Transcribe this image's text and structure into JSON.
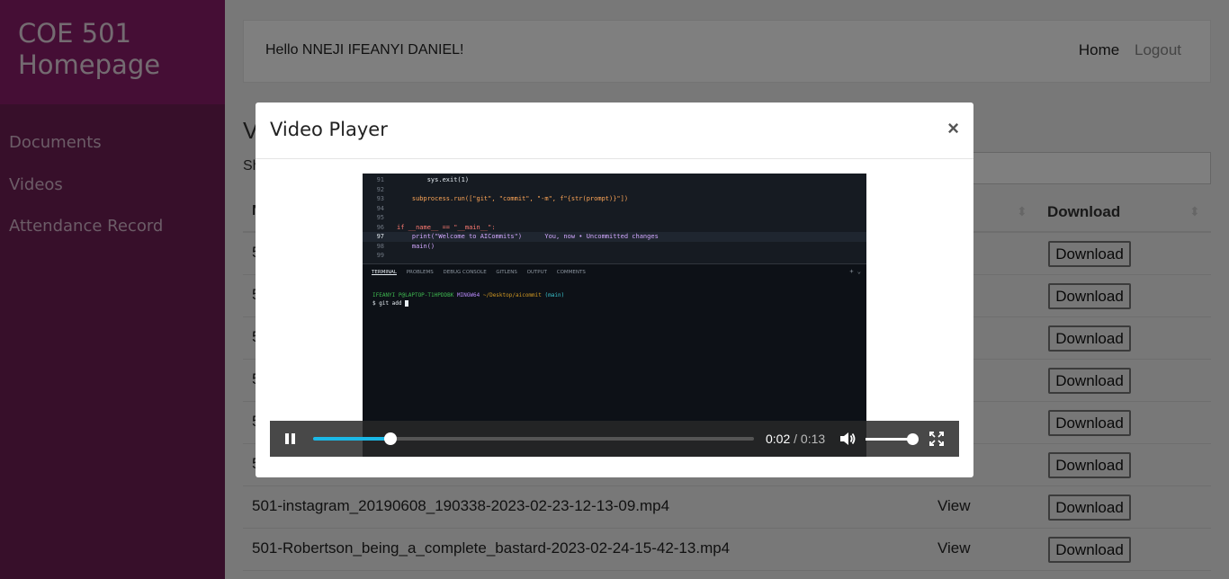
{
  "sidebar": {
    "title_line1": "COE 501",
    "title_line2": "Homepage",
    "items": [
      {
        "label": "Documents"
      },
      {
        "label": "Videos"
      },
      {
        "label": "Attendance Record"
      }
    ]
  },
  "topbar": {
    "greeting": "Hello NNEJI IFEANYI DANIEL!",
    "home": "Home",
    "logout": "Logout"
  },
  "page": {
    "heading_partial": "V",
    "show_partial": "Sh"
  },
  "table": {
    "header_partial": "N",
    "download_header": "Download",
    "rows": [
      {
        "name": "5",
        "view": "",
        "download": "Download"
      },
      {
        "name": "5",
        "view": "",
        "download": "Download"
      },
      {
        "name": "5",
        "view": "",
        "download": "Download"
      },
      {
        "name": "5",
        "view": "",
        "download": "Download"
      },
      {
        "name": "5",
        "view": "",
        "download": "Download"
      },
      {
        "name": "5",
        "view": "",
        "download": "Download"
      },
      {
        "name": "501-instagram_20190608_190338-2023-02-23-12-13-09.mp4",
        "view": "View",
        "download": "Download"
      },
      {
        "name": "501-Robertson_being_a_complete_bastard-2023-02-24-15-42-13.mp4",
        "view": "View",
        "download": "Download"
      }
    ]
  },
  "modal": {
    "title": "Video Player",
    "close": "×"
  },
  "video": {
    "current_time": "0:02",
    "separator": "/",
    "duration": "0:13",
    "progress_fraction": 0.176,
    "volume_fraction": 1.0,
    "code_lines": [
      {
        "ln": "91",
        "code": "        sys.exit(1)"
      },
      {
        "ln": "92",
        "code": ""
      },
      {
        "ln": "93",
        "code": "    subprocess.run([\"git\", \"commit\", \"-m\", f\"{str(prompt)}\"])"
      },
      {
        "ln": "94",
        "code": ""
      },
      {
        "ln": "95",
        "code": ""
      },
      {
        "ln": "96",
        "code": "if __name__ == \"__main__\":"
      },
      {
        "ln": "97",
        "code": "    print(\"Welcome to AICommits\")      You, now • Uncommitted changes"
      },
      {
        "ln": "98",
        "code": "    main()"
      },
      {
        "ln": "99",
        "code": ""
      }
    ],
    "tabs": [
      "TERMINAL",
      "PROBLEMS",
      "DEBUG CONSOLE",
      "GITLENS",
      "OUTPUT",
      "COMMENTS"
    ],
    "terminal_plus": "+ ⌄",
    "prompt_user": "IFEANYI P@LAPTOP-T1HPDDBK",
    "prompt_env": "MINGW64",
    "prompt_path": "~/Desktop/aicommit",
    "prompt_branch": "(main)",
    "command": "$ git add "
  },
  "colors": {
    "sidebar_bg": "#6e1f55",
    "brand_bg": "#8a1d6b",
    "progress_accent": "#1bb8e6"
  }
}
